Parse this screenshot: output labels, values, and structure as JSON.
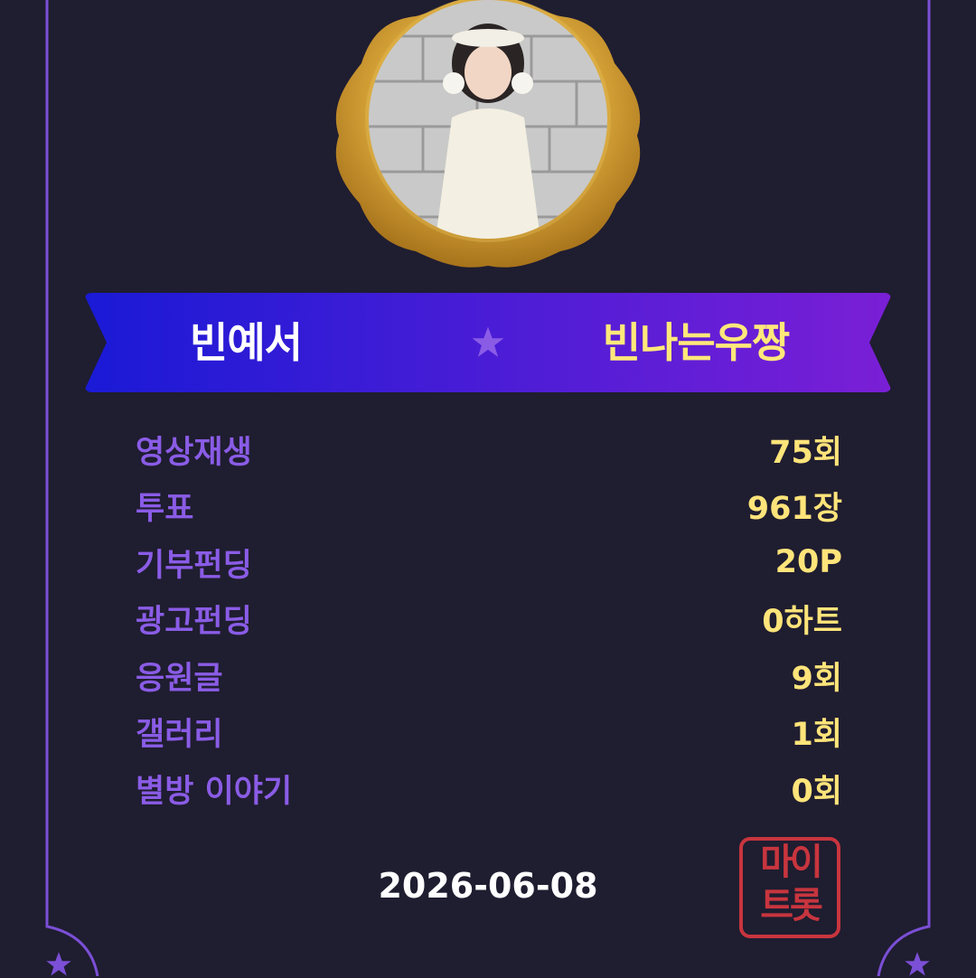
{
  "banner": {
    "left_text": "빈예서",
    "right_text": "빈나는우짱",
    "star_icon": "star-icon"
  },
  "stats": [
    {
      "label": "영상재생",
      "value": "75회"
    },
    {
      "label": "투표",
      "value": "961장"
    },
    {
      "label": "기부펀딩",
      "value": "20P"
    },
    {
      "label": "광고펀딩",
      "value": "0하트"
    },
    {
      "label": "응원글",
      "value": "9회"
    },
    {
      "label": "갤러리",
      "value": "1회"
    },
    {
      "label": "별방 이야기",
      "value": "0회"
    }
  ],
  "footer": {
    "date": "2026-06-08",
    "stamp_line1": "마이",
    "stamp_line2": "트롯"
  },
  "colors": {
    "background": "#1f1d30",
    "frame": "#7b4fd6",
    "label": "#8a5ce6",
    "value": "#ffe47a",
    "banner_start": "#1a1ad6",
    "banner_end": "#7a1fd6",
    "gold": "#d9a63a",
    "stamp": "#c8353e"
  }
}
